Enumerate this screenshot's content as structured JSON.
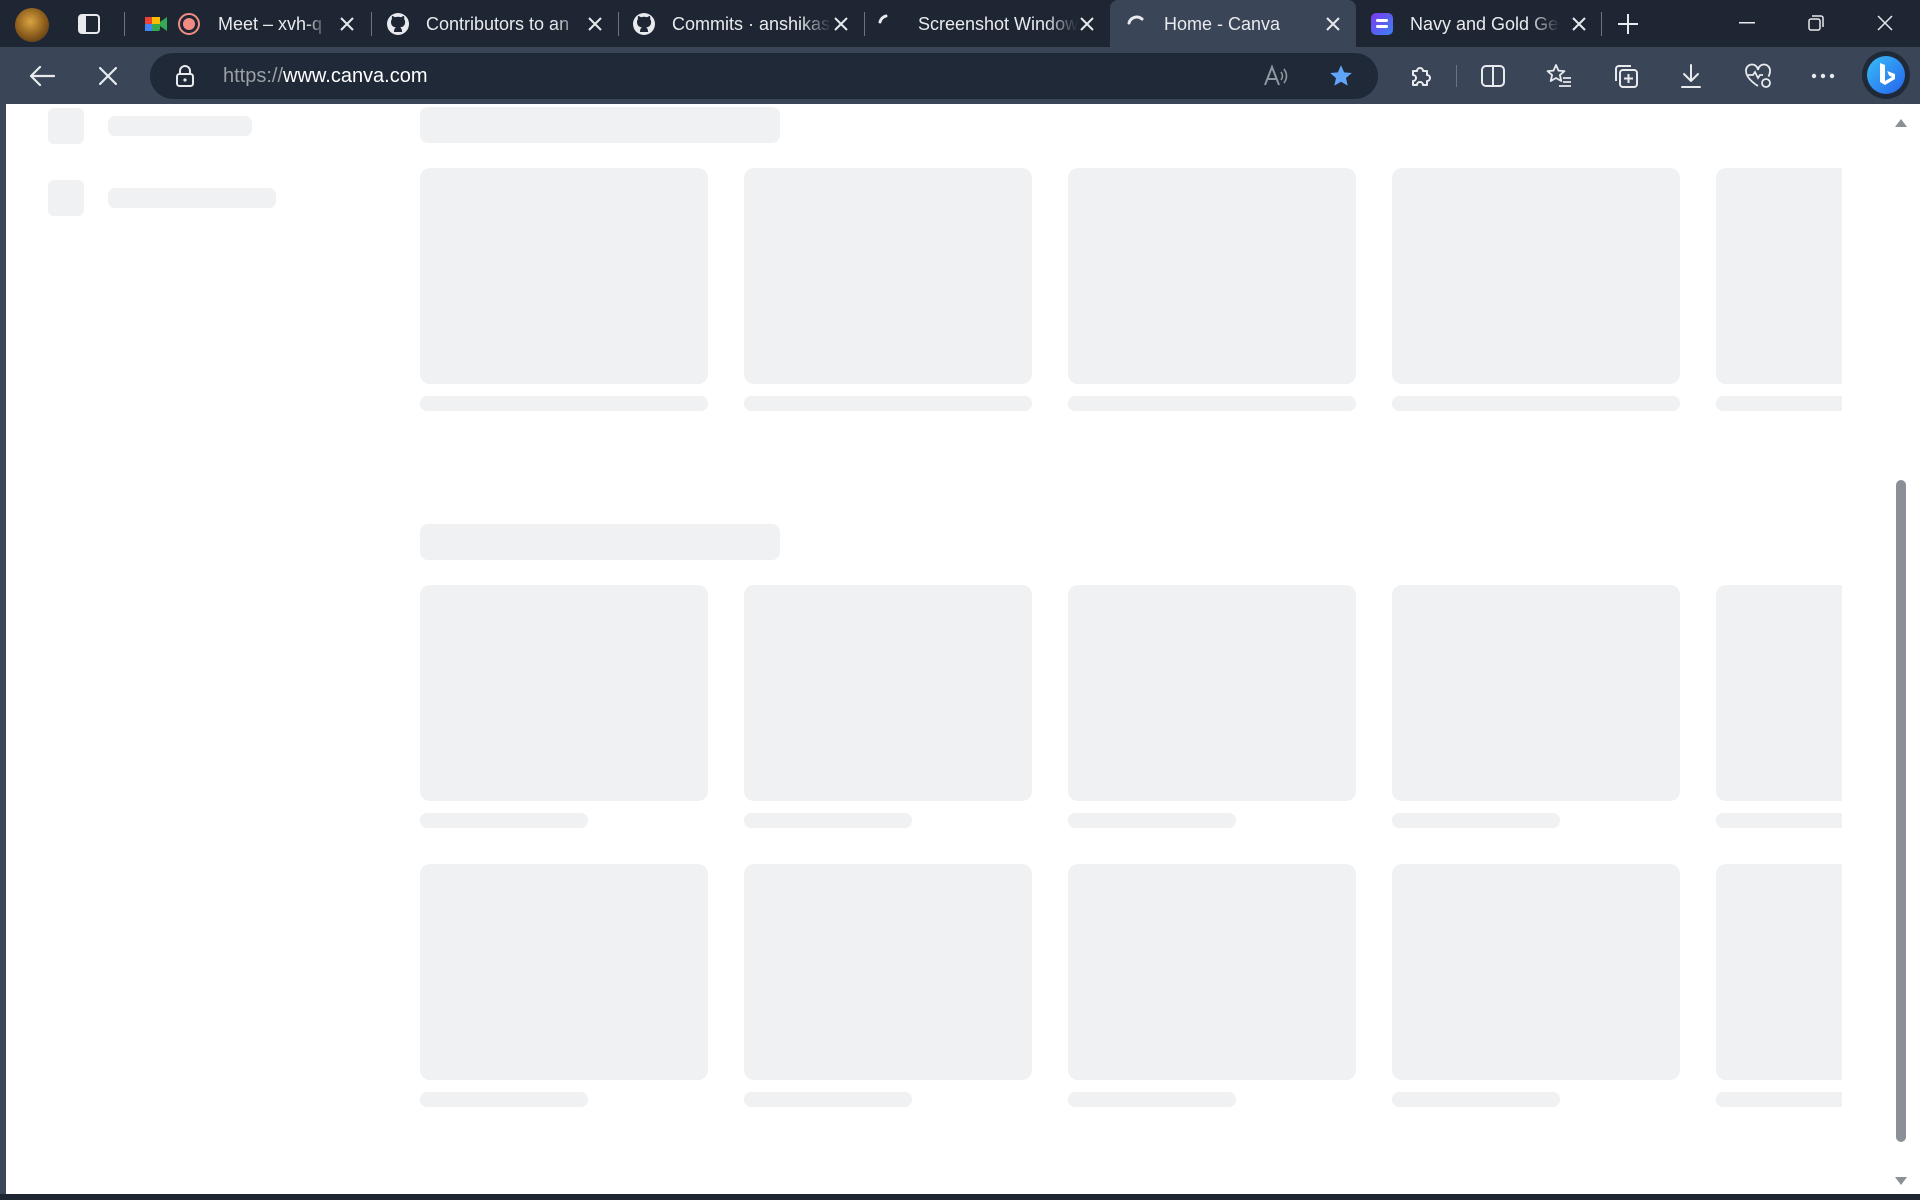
{
  "browser": {
    "tabs": [
      {
        "title": "Meet – xvh-q",
        "favicon": "google-meet-icon",
        "recording": true
      },
      {
        "title": "Contributors to an",
        "favicon": "github-icon"
      },
      {
        "title": "Commits · anshikas",
        "favicon": "github-icon"
      },
      {
        "title": "Screenshot Window",
        "favicon": "loading-icon"
      },
      {
        "title": "Home - Canva",
        "favicon": "loading-icon",
        "active": true
      },
      {
        "title": "Navy and Gold Geo",
        "favicon": "canva-doc-icon"
      }
    ],
    "address_bar": {
      "scheme": "https://",
      "host": "www.canva.com"
    },
    "accent_color": "#60a5fa"
  }
}
